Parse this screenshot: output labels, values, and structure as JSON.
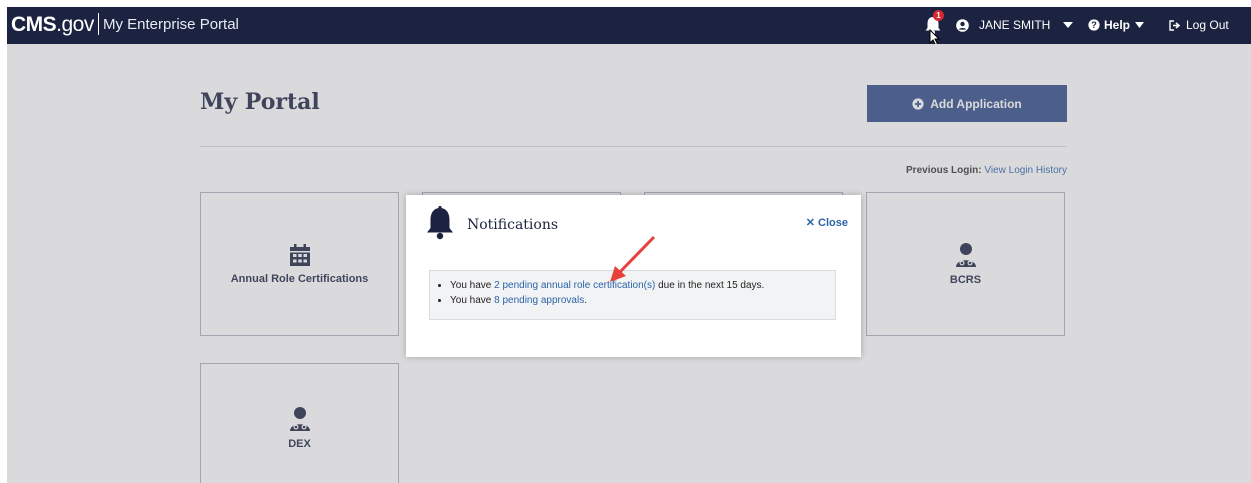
{
  "header": {
    "brand_cms": "CMS",
    "brand_gov": ".gov",
    "portal_name": "My Enterprise Portal",
    "notification_count": "1",
    "user_name": "JANE SMITH",
    "help_label": "Help",
    "logout_label": "Log Out"
  },
  "page": {
    "title": "My Portal",
    "add_button_label": "Add Application",
    "previous_login_label": "Previous Login:",
    "view_history_link": "View Login History"
  },
  "tiles": [
    {
      "label": "Annual Role Certifications",
      "icon": "calendar-icon"
    },
    {
      "label": "BCRS",
      "icon": "user-group-icon"
    },
    {
      "label": "DEX",
      "icon": "user-group-icon"
    }
  ],
  "modal": {
    "title": "Notifications",
    "close_label": "Close",
    "items": [
      {
        "prefix": "You have ",
        "link": "2 pending annual role certification(s)",
        "suffix": " due in the next 15 days."
      },
      {
        "prefix": "You have ",
        "link": "8 pending approvals",
        "suffix": "."
      }
    ]
  },
  "colors": {
    "header_bg": "#1b2340",
    "primary_button": "#2e4a86",
    "link": "#2c63a8",
    "badge": "#d9262e",
    "annotation_arrow": "#e8403a"
  }
}
